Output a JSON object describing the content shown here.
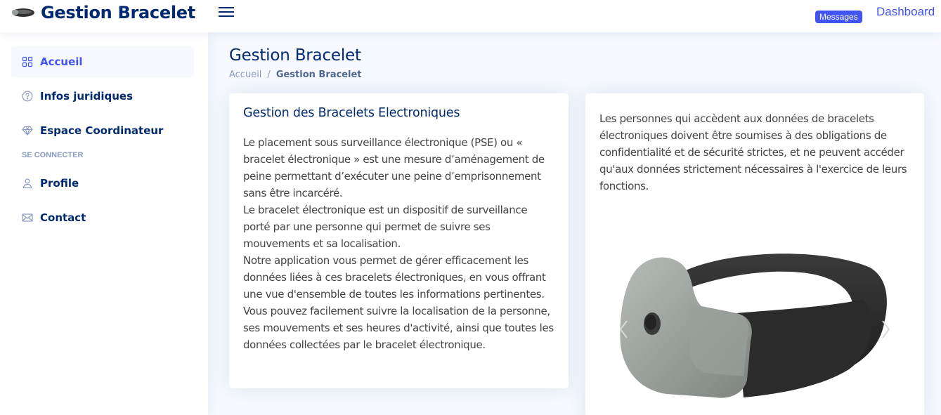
{
  "header": {
    "logo_text": "Gestion Bracelet",
    "messages_label": "Messages",
    "dashboard_label": "Dashboard"
  },
  "sidebar": {
    "items": [
      {
        "label": "Accueil",
        "icon": "grid-icon",
        "active": true
      },
      {
        "label": "Infos juridiques",
        "icon": "question-circle-icon"
      },
      {
        "label": "Espace Coordinateur",
        "icon": "gem-icon"
      }
    ],
    "section_heading": "SE CONNECTER",
    "items2": [
      {
        "label": "Profile",
        "icon": "person-icon"
      },
      {
        "label": "Contact",
        "icon": "envelope-icon"
      }
    ]
  },
  "page": {
    "title": "Gestion Bracelet",
    "breadcrumb": {
      "home": "Accueil",
      "separator": "/",
      "current": "Gestion Bracelet"
    }
  },
  "card_left": {
    "title": "Gestion des Bracelets Electroniques",
    "paragraphs": [
      "Le placement sous surveillance électronique (PSE) ou « bracelet électronique » est une mesure d’aménagement de peine permettant d’exécuter une peine d’emprisonnement sans être incarcéré.",
      "Le bracelet électronique est un dispositif de surveillance porté par une personne qui permet de suivre ses mouvements et sa localisation.",
      "Notre application vous permet de gérer efficacement les données liées à ces bracelets électroniques, en vous offrant une vue d'ensemble de toutes les informations pertinentes. Vous pouvez facilement suivre la localisation de la personne, ses mouvements et ses heures d'activité, ainsi que toutes les données collectées par le bracelet électronique."
    ]
  },
  "card_right": {
    "text": "Les personnes qui accèdent aux données de bracelets électroniques doivent être soumises à des obligations de confidentialité et de sécurité strictes, et ne peuvent accéder qu'aux données strictement nécessaires à l'exercice de leurs fonctions.",
    "carousel": {
      "prev_icon": "chevron-left-icon",
      "next_icon": "chevron-right-icon"
    }
  },
  "colors": {
    "primary": "#4154f1",
    "navy": "#012970",
    "muted": "#899bbd",
    "background": "#f6f9ff"
  }
}
